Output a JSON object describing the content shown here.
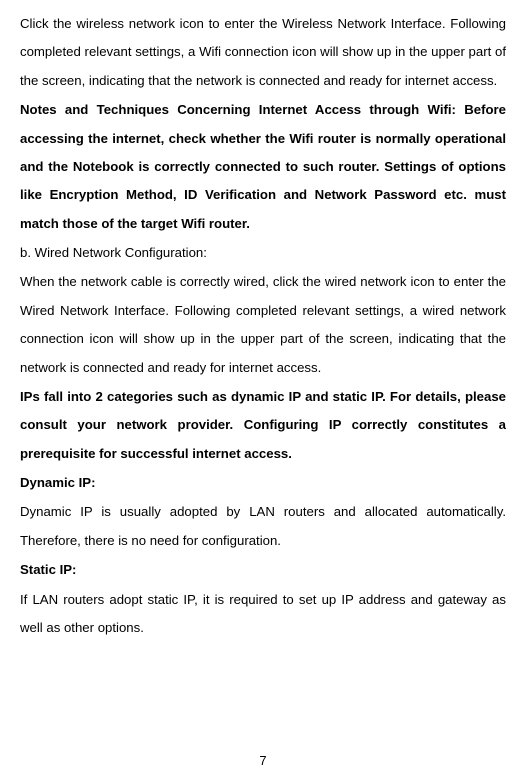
{
  "paragraphs": {
    "p1": "Click the wireless network icon to enter the Wireless Network Interface. Following completed relevant settings, a Wifi connection icon will show up in the upper part of the screen, indicating that the network is connected and ready for internet access.",
    "p2": "Notes and Techniques Concerning Internet Access through Wifi: Before accessing the internet, check whether the Wifi router is normally operational and the Notebook is correctly connected to such router. Settings of options like Encryption Method, ID Verification and Network Password etc. must match those of the target Wifi router.",
    "p3": "b. Wired Network Configuration:",
    "p4": "When the network cable is correctly wired, click the wired network icon to enter the Wired Network Interface. Following completed relevant settings, a wired network connection icon will show up in the upper part of the screen, indicating that the network is connected and ready for internet access.",
    "p5": "IPs fall into 2 categories such as dynamic IP and static IP. For details, please consult your network provider. Configuring IP correctly constitutes a prerequisite for successful internet access.",
    "p6": "Dynamic IP:",
    "p7": "Dynamic IP is usually adopted by LAN routers and allocated automatically. Therefore, there is no need for configuration.",
    "p8": "Static IP:",
    "p9": "If LAN routers adopt static IP, it is required to set up IP address and gateway as well as other options."
  },
  "page_number": "7"
}
